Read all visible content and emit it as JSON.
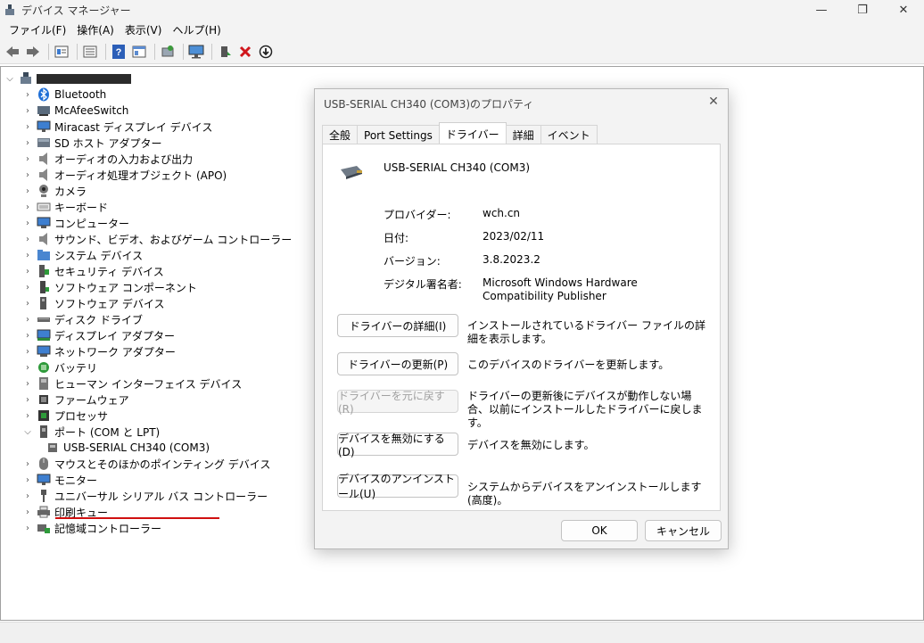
{
  "window": {
    "title": "デバイス マネージャー",
    "controls": {
      "minimize": "—",
      "maximize": "❐",
      "close": "✕"
    }
  },
  "menu": [
    "ファイル(F)",
    "操作(A)",
    "表示(V)",
    "ヘルプ(H)"
  ],
  "toolbar": [
    "back-arrow-icon",
    "forward-arrow-icon",
    "properties-icon",
    "list-icon",
    "help-icon",
    "view-icon",
    "scan-icon",
    "monitor-icon",
    "update-driver-icon",
    "uninstall-icon",
    "download-icon"
  ],
  "tree": {
    "root_label": "",
    "items": [
      {
        "label": "Bluetooth",
        "icon": "bluetooth-icon"
      },
      {
        "label": "McAfeeSwitch",
        "icon": "network-icon"
      },
      {
        "label": "Miracast ディスプレイ デバイス",
        "icon": "display-icon"
      },
      {
        "label": "SD ホスト アダプター",
        "icon": "sd-card-icon"
      },
      {
        "label": "オーディオの入力および出力",
        "icon": "speaker-icon"
      },
      {
        "label": "オーディオ処理オブジェクト (APO)",
        "icon": "speaker-icon"
      },
      {
        "label": "カメラ",
        "icon": "camera-icon"
      },
      {
        "label": "キーボード",
        "icon": "keyboard-icon"
      },
      {
        "label": "コンピューター",
        "icon": "computer-icon"
      },
      {
        "label": "サウンド、ビデオ、およびゲーム コントローラー",
        "icon": "speaker-icon"
      },
      {
        "label": "システム デバイス",
        "icon": "system-folder-icon"
      },
      {
        "label": "セキュリティ デバイス",
        "icon": "security-icon"
      },
      {
        "label": "ソフトウェア コンポーネント",
        "icon": "software-component-icon"
      },
      {
        "label": "ソフトウェア デバイス",
        "icon": "software-device-icon"
      },
      {
        "label": "ディスク ドライブ",
        "icon": "disk-drive-icon"
      },
      {
        "label": "ディスプレイ アダプター",
        "icon": "display-adapter-icon"
      },
      {
        "label": "ネットワーク アダプター",
        "icon": "network-adapter-icon"
      },
      {
        "label": "バッテリ",
        "icon": "battery-icon"
      },
      {
        "label": "ヒューマン インターフェイス デバイス",
        "icon": "hid-icon"
      },
      {
        "label": "ファームウェア",
        "icon": "firmware-icon"
      },
      {
        "label": "プロセッサ",
        "icon": "processor-icon"
      },
      {
        "label": "ポート (COM と LPT)",
        "icon": "port-icon",
        "expanded": true
      },
      {
        "label": "USB-SERIAL CH340 (COM3)",
        "icon": "serial-port-icon",
        "child": true
      },
      {
        "label": "マウスとそのほかのポインティング デバイス",
        "icon": "mouse-icon"
      },
      {
        "label": "モニター",
        "icon": "monitor-icon"
      },
      {
        "label": "ユニバーサル シリアル バス コントローラー",
        "icon": "usb-icon"
      },
      {
        "label": "印刷キュー",
        "icon": "printer-icon"
      },
      {
        "label": "記憶域コントローラー",
        "icon": "storage-controller-icon"
      }
    ]
  },
  "dialog": {
    "title": "USB-SERIAL CH340 (COM3)のプロパティ",
    "tabs": [
      "全般",
      "Port Settings",
      "ドライバー",
      "詳細",
      "イベント"
    ],
    "active_tab": "ドライバー",
    "device_name": "USB-SERIAL CH340 (COM3)",
    "props": [
      {
        "label": "プロバイダー:",
        "value": "wch.cn"
      },
      {
        "label": "日付:",
        "value": "2023/02/11"
      },
      {
        "label": "バージョン:",
        "value": "3.8.2023.2"
      },
      {
        "label": "デジタル署名者:",
        "value": "Microsoft Windows Hardware Compatibility Publisher"
      }
    ],
    "actions": [
      {
        "label": "ドライバーの詳細(I)",
        "desc": "インストールされているドライバー ファイルの詳細を表示します。",
        "enabled": true
      },
      {
        "label": "ドライバーの更新(P)",
        "desc": "このデバイスのドライバーを更新します。",
        "enabled": true
      },
      {
        "label": "ドライバーを元に戻す(R)",
        "desc": "ドライバーの更新後にデバイスが動作しない場合、以前にインストールしたドライバーに戻します。",
        "enabled": false
      },
      {
        "label": "デバイスを無効にする(D)",
        "desc": "デバイスを無効にします。",
        "enabled": true
      },
      {
        "label": "デバイスのアンインストール(U)",
        "desc": "システムからデバイスをアンインストールします (高度)。",
        "enabled": true
      }
    ],
    "ok": "OK",
    "cancel": "キャンセル"
  }
}
